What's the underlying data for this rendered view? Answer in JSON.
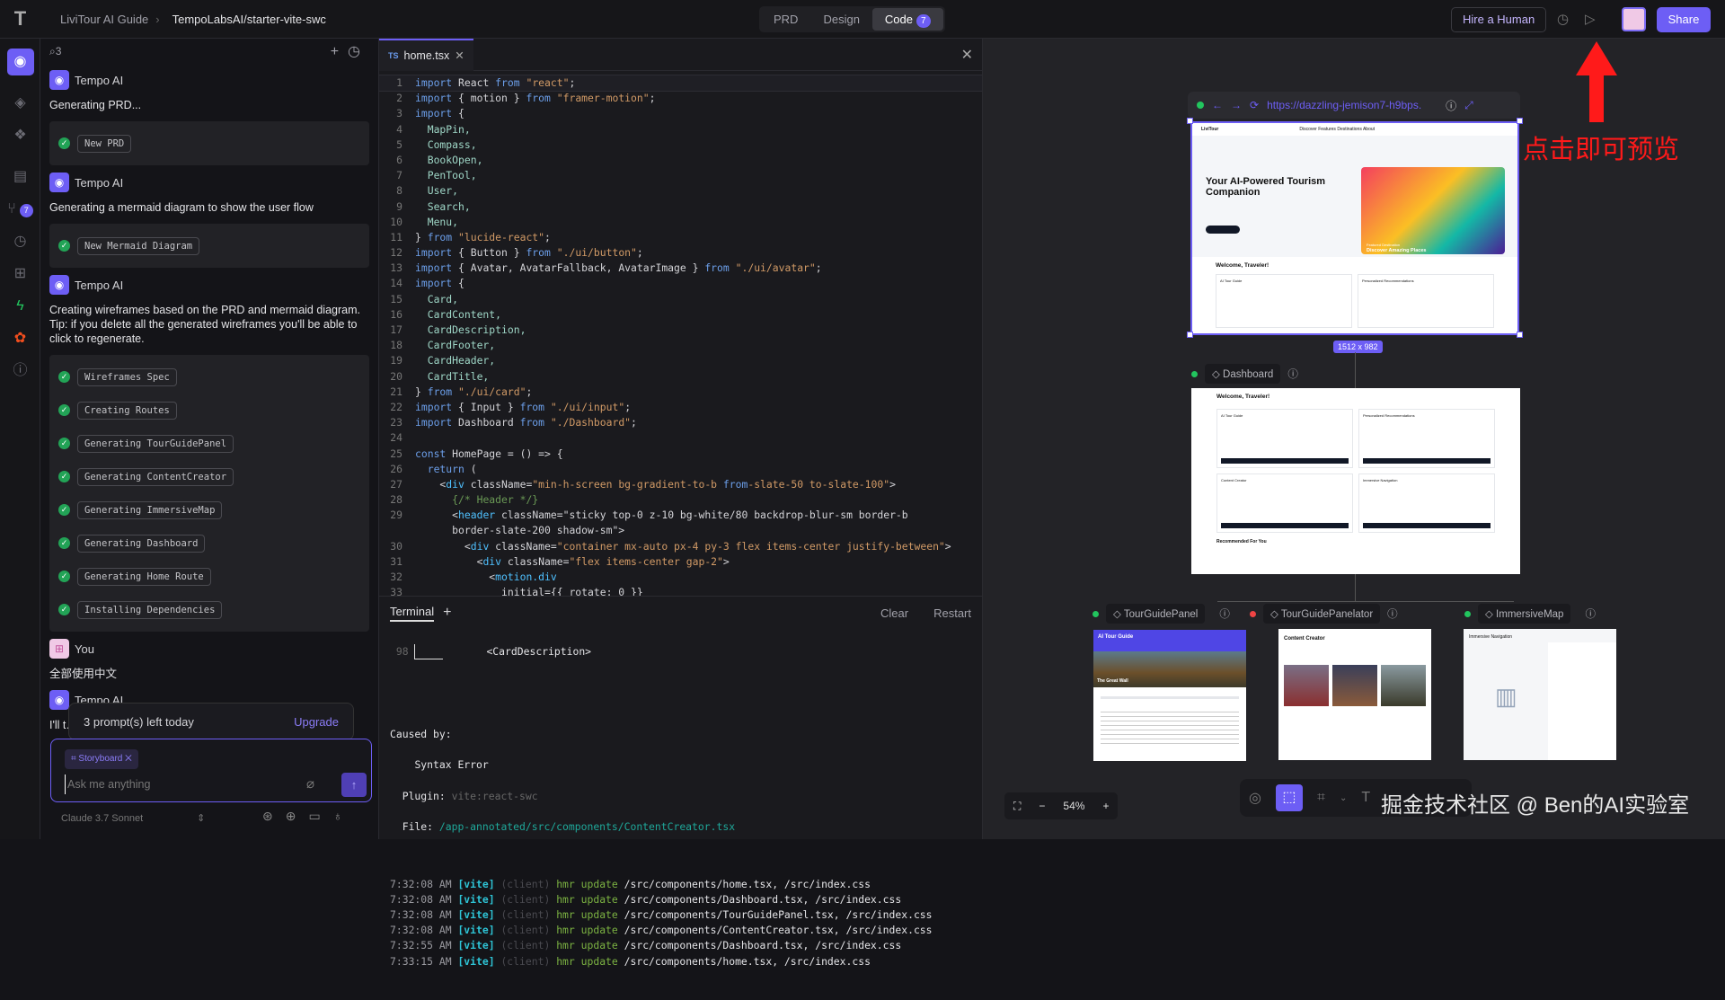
{
  "header": {
    "project": "LiviTour AI Guide",
    "repo": "TempoLabsAI/starter-vite-swc",
    "tabs": [
      {
        "label": "PRD"
      },
      {
        "label": "Design"
      },
      {
        "label": "Code",
        "badge": "7"
      }
    ],
    "hire": "Hire a Human",
    "share": "Share"
  },
  "rail": {
    "badge": "7"
  },
  "chat": {
    "count": "3",
    "messages": [
      {
        "author": "Tempo AI",
        "text": "Generating PRD...",
        "steps": [
          "New PRD"
        ]
      },
      {
        "author": "Tempo AI",
        "text": "Generating a mermaid diagram to show the user flow",
        "steps": [
          "New Mermaid Diagram"
        ]
      },
      {
        "author": "Tempo AI",
        "text": "Creating wireframes based on the PRD and mermaid diagram. Tip: if you delete all the generated wireframes you'll be able to click to regenerate.",
        "steps": [
          "Wireframes Spec",
          "Creating Routes",
          "Generating TourGuidePanel",
          "Generating ContentCreator",
          "Generating ImmersiveMap",
          "Generating Dashboard",
          "Generating Home Route",
          "Installing Dependencies"
        ]
      },
      {
        "author": "You",
        "text": "全部使用中文",
        "steps": []
      },
      {
        "author": "Tempo AI",
        "text": "I'll t… star…",
        "steps": []
      }
    ],
    "quota": "3 prompt(s) left today",
    "upgrade": "Upgrade",
    "chip": "Storyboard",
    "placeholder": "Ask me anything",
    "model": "Claude 3.7 Sonnet"
  },
  "editor": {
    "tab": "home.tsx",
    "tab_lang": "TS",
    "code": [
      "import React from \"react\";",
      "import { motion } from \"framer-motion\";",
      "import {",
      "  MapPin,",
      "  Compass,",
      "  BookOpen,",
      "  PenTool,",
      "  User,",
      "  Search,",
      "  Menu,",
      "} from \"lucide-react\";",
      "import { Button } from \"./ui/button\";",
      "import { Avatar, AvatarFallback, AvatarImage } from \"./ui/avatar\";",
      "import {",
      "  Card,",
      "  CardContent,",
      "  CardDescription,",
      "  CardFooter,",
      "  CardHeader,",
      "  CardTitle,",
      "} from \"./ui/card\";",
      "import { Input } from \"./ui/input\";",
      "import Dashboard from \"./Dashboard\";",
      "",
      "const HomePage = () => {",
      "  return (",
      "    <div className=\"min-h-screen bg-gradient-to-b from-slate-50 to-slate-100\">",
      "      {/* Header */}",
      "      <header className=\"sticky top-0 z-10 bg-white/80 backdrop-blur-sm border-b",
      "      border-slate-200 shadow-sm\">",
      "        <div className=\"container mx-auto px-4 py-3 flex items-center justify-between\">",
      "          <div className=\"flex items-center gap-2\">",
      "            <motion.div",
      "              initial={{ rotate: 0 }}",
      "              animate={{ rotate: 360 }}"
    ],
    "line_numbers": [
      "1",
      "2",
      "3",
      "4",
      "5",
      "6",
      "7",
      "8",
      "9",
      "10",
      "11",
      "12",
      "13",
      "14",
      "15",
      "16",
      "17",
      "18",
      "19",
      "20",
      "21",
      "22",
      "23",
      "24",
      "25",
      "26",
      "27",
      "28",
      "29",
      "",
      "30",
      "31",
      "32",
      "33",
      "34"
    ]
  },
  "terminal": {
    "tab": "Terminal",
    "clear": "Clear",
    "restart": "Restart",
    "snippet_line": "98",
    "snippet": "<CardDescription>",
    "caused": "Caused by:",
    "error": "Syntax Error",
    "plugin_label": "Plugin:",
    "plugin": "vite:react-swc",
    "file_label": "File:",
    "file": "/app-annotated/src/components/ContentCreator.tsx",
    "logs": [
      {
        "time": "7:32:08 AM",
        "tag": "[vite]",
        "src": "(client)",
        "act": "hmr update",
        "path": "/src/components/home.tsx, /src/index.css"
      },
      {
        "time": "7:32:08 AM",
        "tag": "[vite]",
        "src": "(client)",
        "act": "hmr update",
        "path": "/src/components/Dashboard.tsx, /src/index.css"
      },
      {
        "time": "7:32:08 AM",
        "tag": "[vite]",
        "src": "(client)",
        "act": "hmr update",
        "path": "/src/components/TourGuidePanel.tsx, /src/index.css"
      },
      {
        "time": "7:32:08 AM",
        "tag": "[vite]",
        "src": "(client)",
        "act": "hmr update",
        "path": "/src/components/ContentCreator.tsx, /src/index.css"
      },
      {
        "time": "7:32:55 AM",
        "tag": "[vite]",
        "src": "(client)",
        "act": "hmr update",
        "path": "/src/components/Dashboard.tsx, /src/index.css"
      },
      {
        "time": "7:33:15 AM",
        "tag": "[vite]",
        "src": "(client)",
        "act": "hmr update",
        "path": "/src/components/home.tsx, /src/index.css"
      }
    ]
  },
  "preview": {
    "url": "https://dazzling-jemison7-h9bps.",
    "size": "1512 x 982",
    "home": {
      "brand": "LiviTour",
      "nav": [
        "Discover",
        "Features",
        "Destinations",
        "About"
      ],
      "hero": "Your AI-Powered Tourism Companion",
      "featured": "Featured Destination",
      "discover": "Discover Amazing Places",
      "welcome": "Welcome, Traveler!",
      "card1": "AI Tour Guide",
      "card2": "Personalized Recommendations"
    },
    "dashboard": {
      "label": "Dashboard",
      "title": "Welcome, Traveler!",
      "cards": [
        "AI Tour Guide",
        "Personalized Recommendations",
        "Content Creator",
        "Immersive Navigation"
      ],
      "recommended": "Recommended For You"
    },
    "frames": [
      {
        "label": "TourGuidePanel",
        "title": "AI Tour Guide",
        "place": "The Great Wall",
        "status": "#22c55e"
      },
      {
        "label": "TourGuidePanel",
        "label_suffix": "ator",
        "title": "Content Creator",
        "status": "#ef4444"
      },
      {
        "label": "ImmersiveMap",
        "title": "Immersive Navigation",
        "status": "#22c55e"
      }
    ],
    "zoom": "54%"
  },
  "annotation": "点击即可预览",
  "watermark": "掘金技术社区 @ Ben的AI实验室",
  "colors": {
    "accent": "#6d5ef5",
    "success": "#22c55e",
    "error": "#ef4444"
  }
}
